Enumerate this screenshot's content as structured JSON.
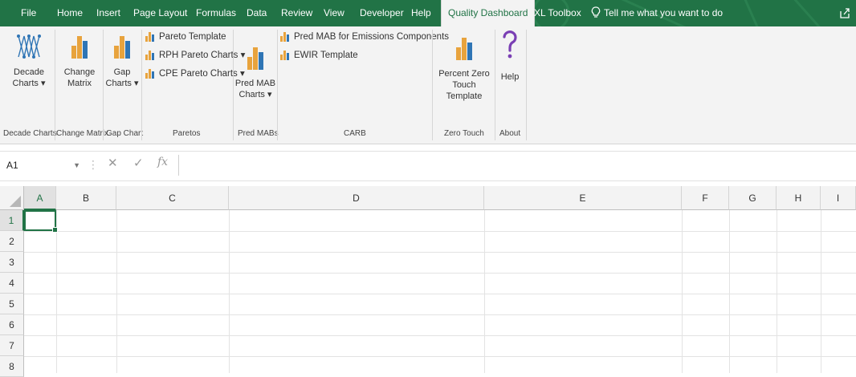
{
  "tabs": [
    {
      "label": "File",
      "active": false
    },
    {
      "label": "Home",
      "active": false
    },
    {
      "label": "Insert",
      "active": false
    },
    {
      "label": "Page Layout",
      "active": false
    },
    {
      "label": "Formulas",
      "active": false
    },
    {
      "label": "Data",
      "active": false
    },
    {
      "label": "Review",
      "active": false
    },
    {
      "label": "View",
      "active": false
    },
    {
      "label": "Developer",
      "active": false
    },
    {
      "label": "Help",
      "active": false
    },
    {
      "label": "Quality Dashboard",
      "active": true
    },
    {
      "label": "XL Toolbox",
      "active": false
    }
  ],
  "tell_me": "Tell me what you want to do",
  "ribbon": {
    "decade": {
      "line1": "Decade",
      "line2": "Charts ▾",
      "group": "Decade Charts"
    },
    "change": {
      "line1": "Change",
      "line2": "Matrix",
      "group": "Change Matrix"
    },
    "gap": {
      "line1": "Gap",
      "line2": "Charts ▾",
      "group": "Gap Chart"
    },
    "paretos": {
      "items": [
        "Pareto Template",
        "RPH Pareto Charts ▾",
        "CPE Pareto Charts ▾"
      ],
      "group": "Paretos"
    },
    "predmab": {
      "line1": "Pred MAB",
      "line2": "Charts ▾",
      "group": "Pred MABs"
    },
    "carb": {
      "items": [
        "Pred MAB for Emissions Components",
        "EWIR Template"
      ],
      "group": "CARB"
    },
    "zero": {
      "line1": "Percent Zero",
      "line2": "Touch Template",
      "group": "Zero Touch"
    },
    "help": {
      "label": "Help",
      "group": "About"
    }
  },
  "formula_bar": {
    "name_box": "A1",
    "cancel": "✕",
    "enter": "✓",
    "fx": "fx",
    "value": ""
  },
  "columns": [
    "A",
    "B",
    "C",
    "D",
    "E",
    "F",
    "G",
    "H",
    "I"
  ],
  "rows": [
    "1",
    "2",
    "3",
    "4",
    "5",
    "6",
    "7",
    "8"
  ],
  "selected_cell": "A1",
  "colors": {
    "accent": "#217346",
    "ribbon_bg": "#f3f3f3",
    "icon_orange": "#e8a33d",
    "icon_blue": "#2f75b5",
    "help_purple": "#7a3fb4"
  }
}
